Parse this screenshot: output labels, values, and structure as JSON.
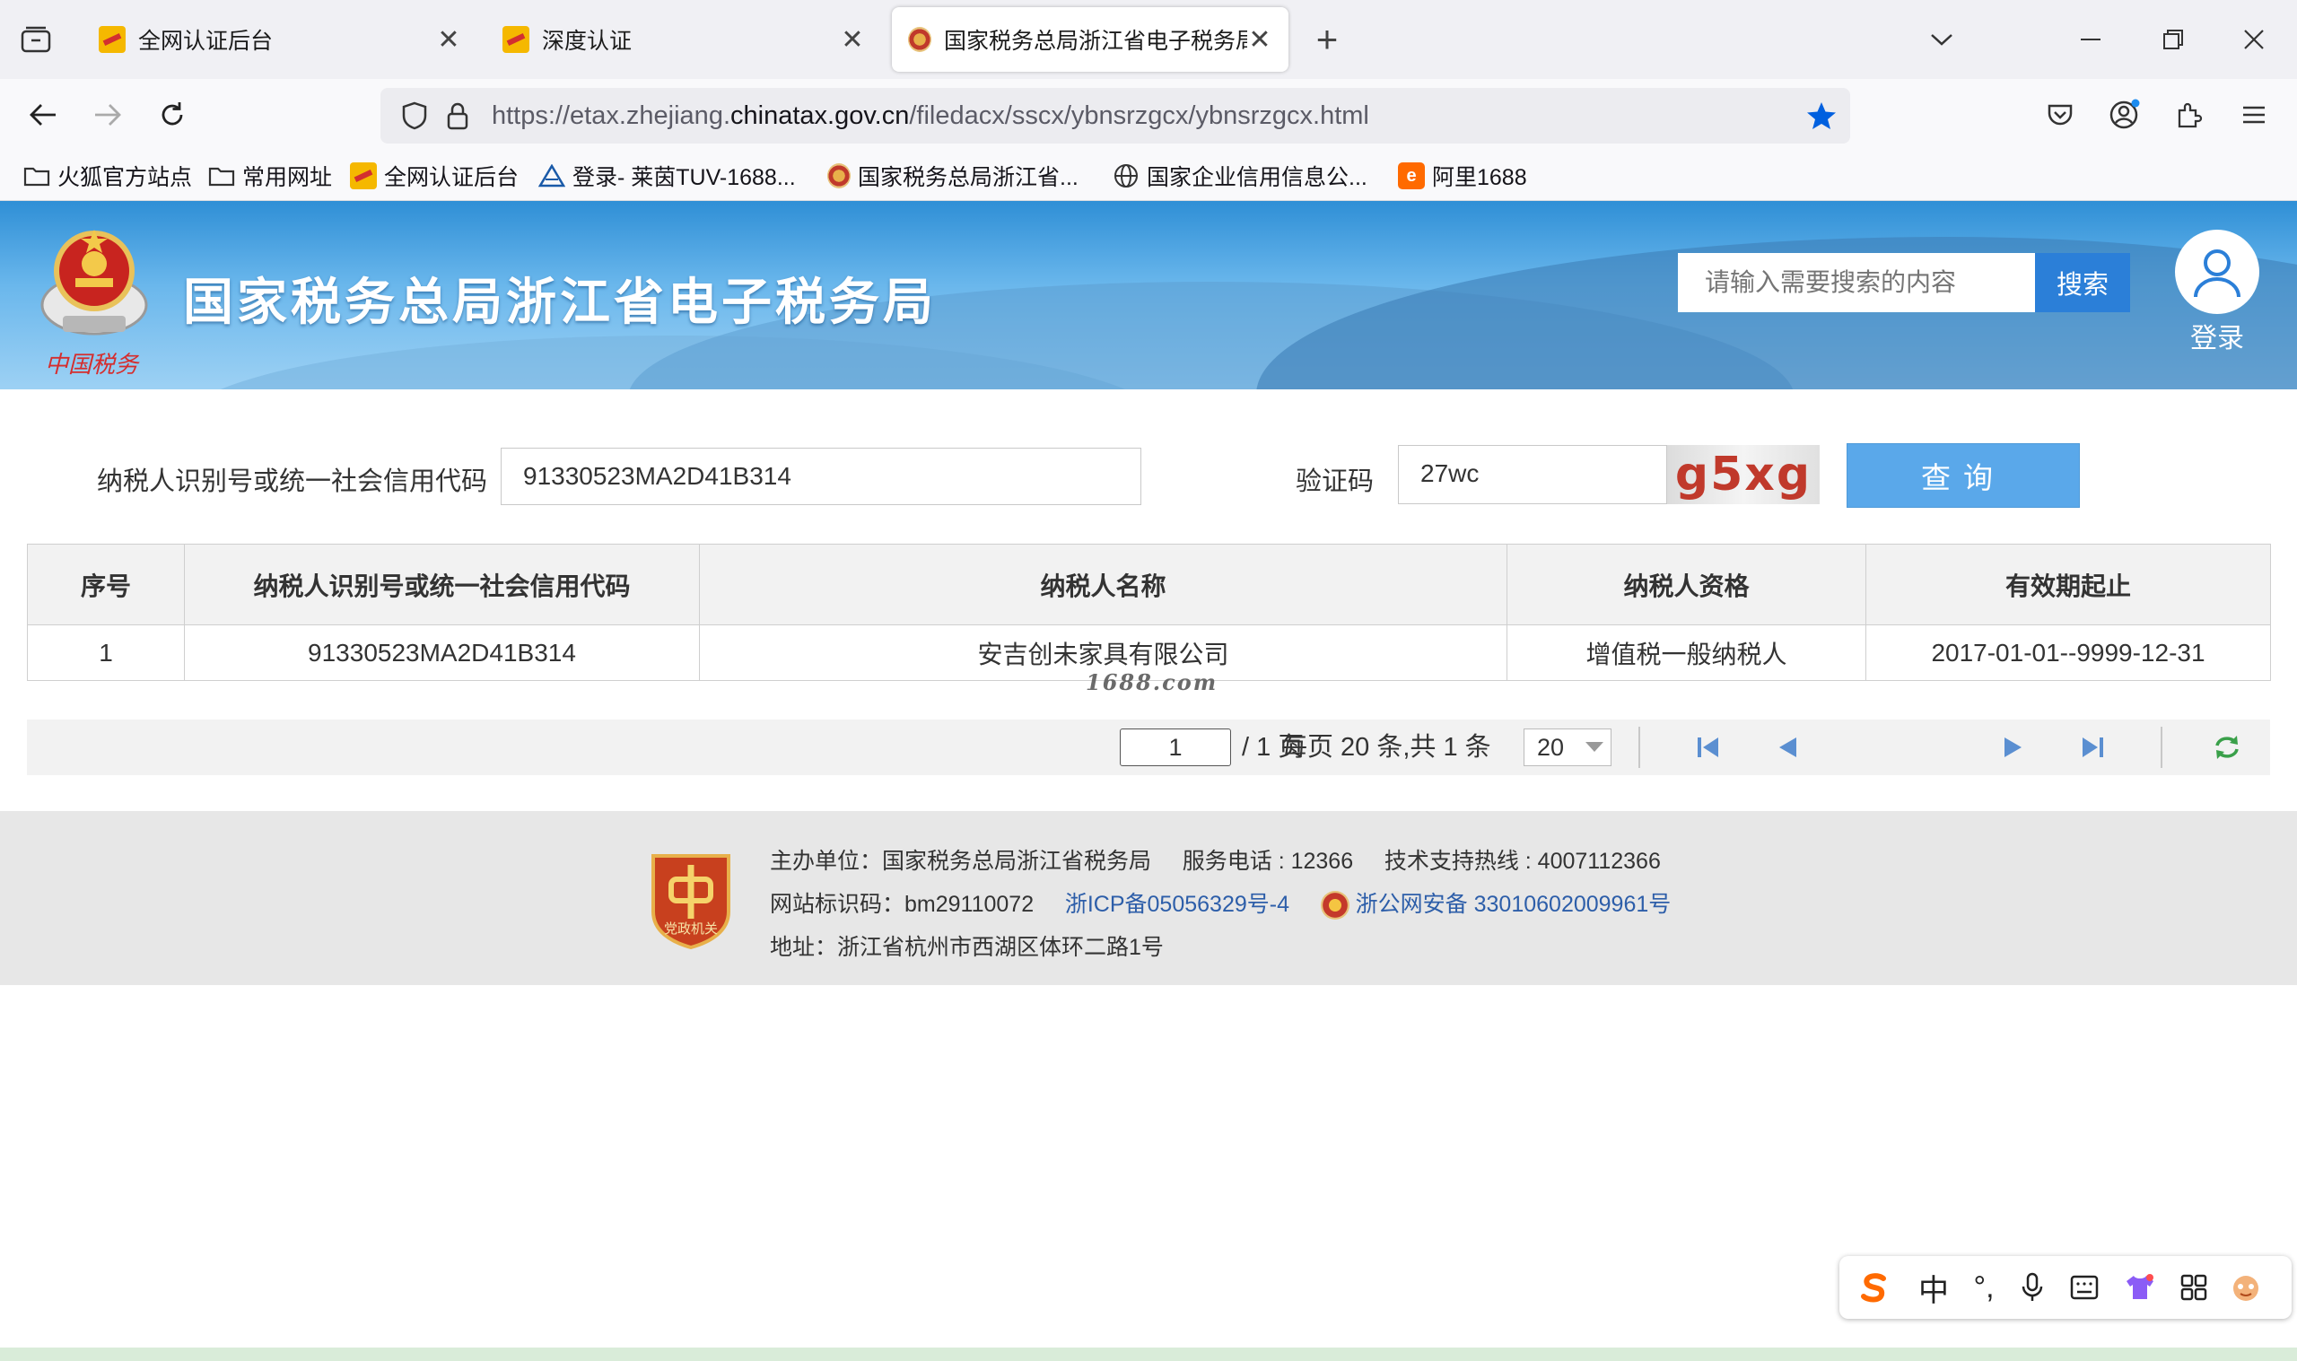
{
  "browser": {
    "tabs": [
      {
        "label": "全网认证后台",
        "close": "✕",
        "active": false
      },
      {
        "label": "深度认证",
        "close": "✕",
        "active": false
      },
      {
        "label": "国家税务总局浙江省电子税务局",
        "close": "✕",
        "active": true
      }
    ],
    "new_tab": "+",
    "url_prefix": "https://etax.zhejiang.",
    "url_host": "chinatax.gov.cn",
    "url_path": "/filedacx/sscx/ybnsrzgcx/ybnsrzgcx.html",
    "bookmarks": [
      {
        "label": "火狐官方站点",
        "icon": "folder-icon"
      },
      {
        "label": "常用网址",
        "icon": "folder-icon"
      },
      {
        "label": "全网认证后台",
        "icon": "site-icon"
      },
      {
        "label": "登录- 莱茵TUV-1688...",
        "icon": "triangle-icon"
      },
      {
        "label": "国家税务总局浙江省...",
        "icon": "emblem-icon"
      },
      {
        "label": "国家企业信用信息公...",
        "icon": "globe-icon"
      },
      {
        "label": "阿里1688",
        "icon": "alibaba-icon"
      }
    ]
  },
  "site": {
    "title": "国家税务总局浙江省电子税务局",
    "emblem_text": "中国税务",
    "search_placeholder": "请输入需要搜索的内容",
    "search_button": "搜索",
    "login_label": "登录"
  },
  "form": {
    "taxpayer_id_label": "纳税人识别号或统一社会信用代码",
    "taxpayer_id_value": "91330523MA2D41B314",
    "captcha_label": "验证码",
    "captcha_value": "27wc",
    "captcha_image_text": "g5xg",
    "query_button": "查询"
  },
  "table": {
    "headers": [
      "序号",
      "纳税人识别号或统一社会信用代码",
      "纳税人名称",
      "纳税人资格",
      "有效期起止"
    ],
    "rows": [
      [
        "1",
        "91330523MA2D41B314",
        "安吉创未家具有限公司",
        "增值税一般纳税人",
        "2017-01-01--9999-12-31"
      ]
    ],
    "watermark": "1688.com"
  },
  "pager": {
    "info": "每页 20 条,共 1 条",
    "page_size": "20",
    "current_page": "1",
    "total_pages": "/ 1 页"
  },
  "footer": {
    "logo_text": "党政机关",
    "sponsor": "主办单位：国家税务总局浙江省税务局",
    "service_phone": "服务电话 : 12366",
    "tech_support": "技术支持热线 : 4007112366",
    "site_code": "网站标识码：bm29110072",
    "icp": "浙ICP备05056329号-4",
    "police_record": "浙公网安备 33010602009961号",
    "address": "地址：浙江省杭州市西湖区体环二路1号"
  },
  "ime": {
    "lang": "中",
    "punct": "°,"
  },
  "colors": {
    "accent_blue": "#2b7fd8",
    "query_button": "#5aa8ea",
    "captcha_red": "#c0392b",
    "link_blue": "#2d5ea9",
    "bookmark_star": "#0060df"
  }
}
